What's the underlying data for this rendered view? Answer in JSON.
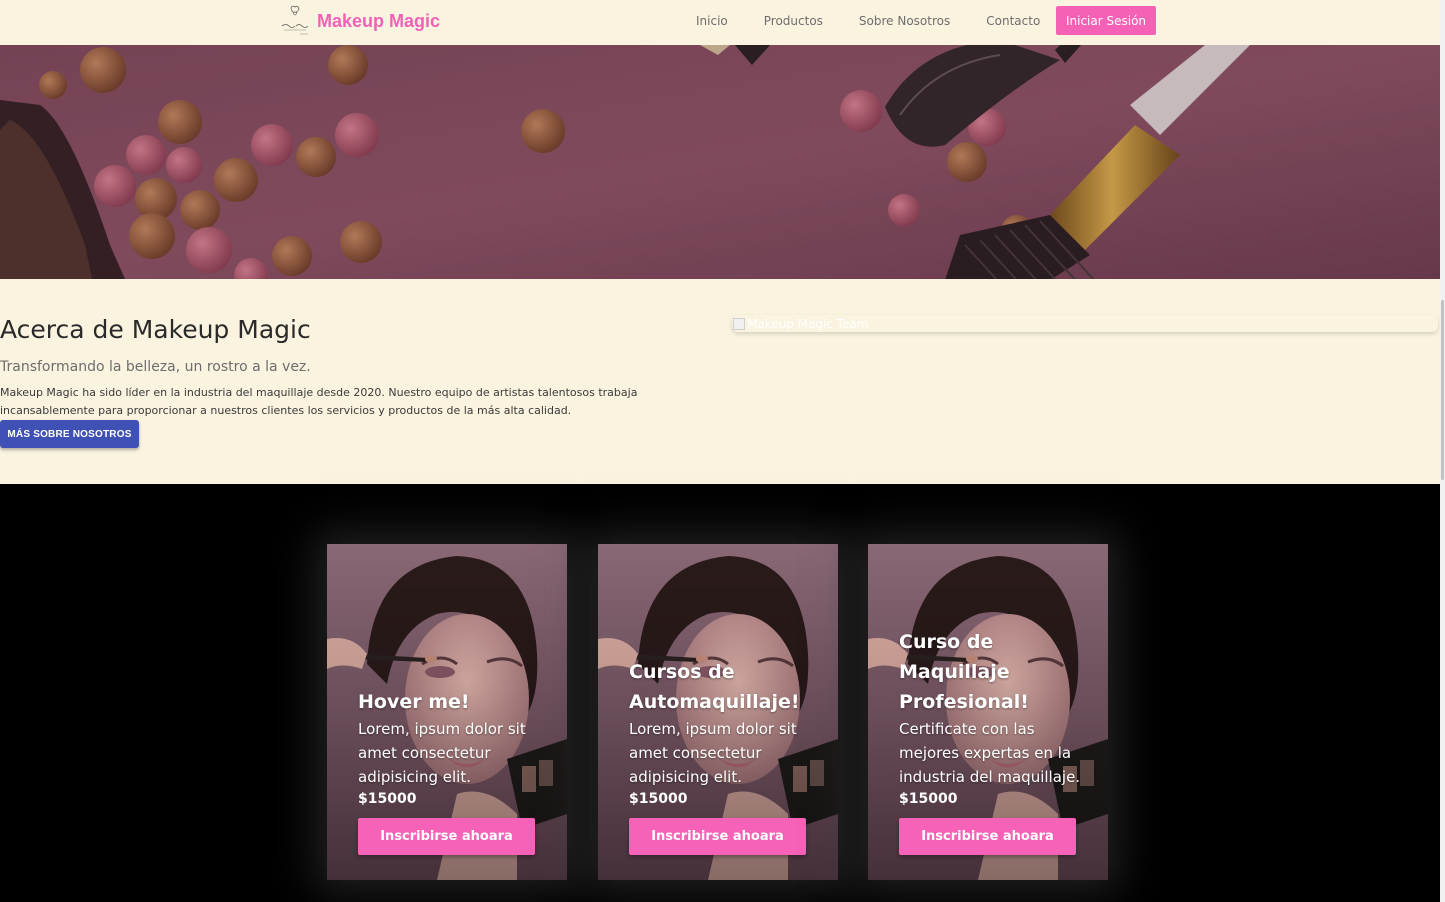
{
  "navbar": {
    "brand_name": "Makeup Magic",
    "links": [
      "Inicio",
      "Productos",
      "Sobre Nosotros",
      "Contacto"
    ],
    "login_label": "Iniciar Sesión",
    "background_color": "#faf3e0",
    "brand_color": "#f062b8"
  },
  "about": {
    "title": "Acerca de Makeup Magic",
    "subtitle": "Transformando la belleza, un rostro a la vez.",
    "text": "Makeup Magic ha sido líder en la industria del maquillaje desde 2020. Nuestro equipo de artistas talentosos trabaja incansablemente para proporcionar a nuestros clientes los servicios y productos de la más alta calidad.",
    "button_label": "MÁS SOBRE NOSOTROS",
    "image_alt": "Makeup Magic Team",
    "button_color": "#3f51b5"
  },
  "cards": [
    {
      "title": "Hover me!",
      "text": "Lorem, ipsum dolor sit amet consectetur adipisicing elit.",
      "price": "$15000",
      "button_label": "Inscribirse ahoara"
    },
    {
      "title": "Cursos de Automaquillaje!",
      "text": "Lorem, ipsum dolor sit amet consectetur adipisicing elit.",
      "price": "$15000",
      "button_label": "Inscribirse ahoara"
    },
    {
      "title": "Curso de Maquillaje Profesional!",
      "text": "Certificate con las mejores expertas en la industria del maquillaje.",
      "price": "$15000",
      "button_label": "Inscribirse ahoara"
    }
  ],
  "icons": {
    "logo": "makeup-magic-logo",
    "hero_image": "makeup-brushes-and-blush-pearls",
    "card_image": "woman-applying-eyeshadow",
    "broken_image": "broken-image-icon"
  },
  "colors": {
    "accent_pink": "#f562b5",
    "cards_background": "#000000",
    "hero_overlay": "#6b3a4e"
  }
}
